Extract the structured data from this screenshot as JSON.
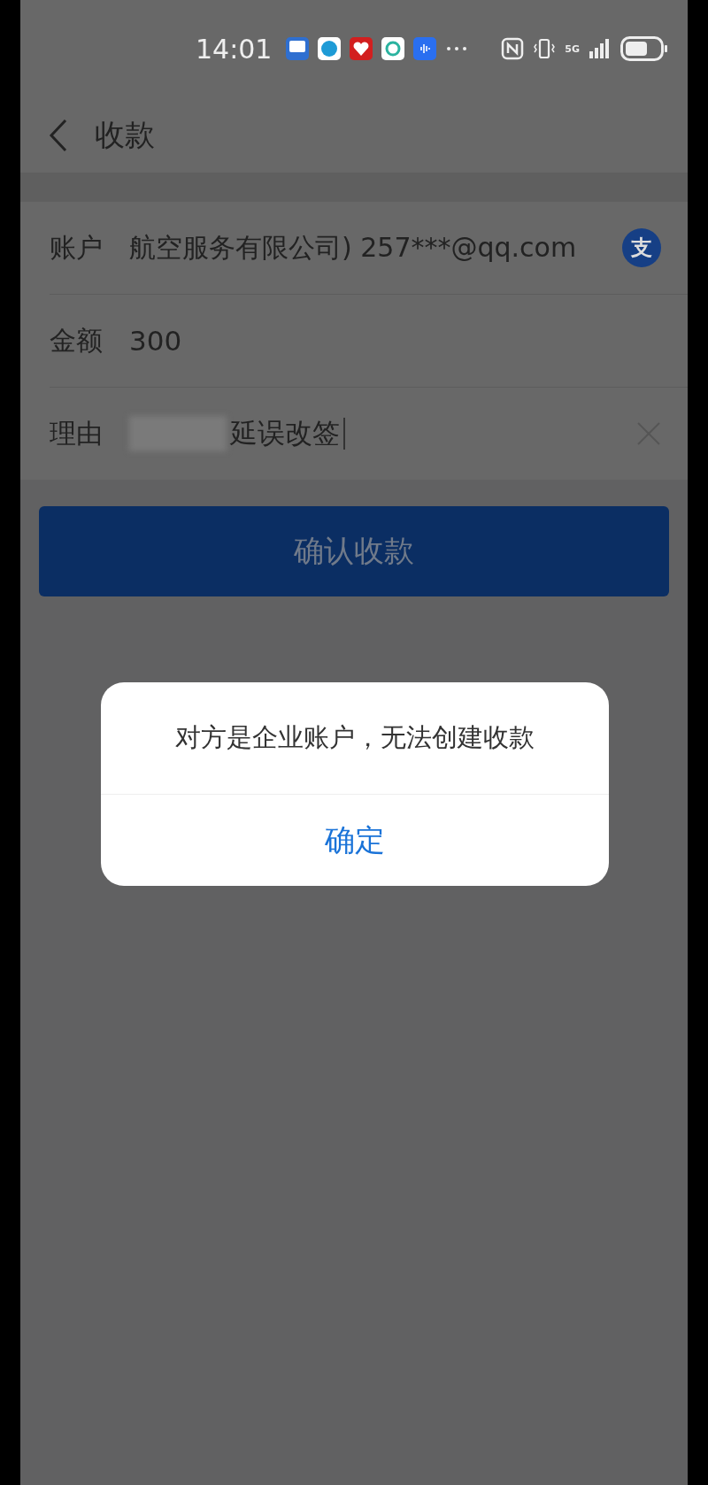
{
  "status_bar": {
    "time": "14:01",
    "network": "5G"
  },
  "header": {
    "title": "收款"
  },
  "form": {
    "rows": [
      {
        "kind": "account",
        "label": "账户",
        "value": "航空服务有限公司) 257***@qq.com",
        "badge": "支"
      },
      {
        "kind": "text",
        "label": "金额",
        "value": "300"
      },
      {
        "kind": "input",
        "label": "理由",
        "value": "延误改签"
      }
    ]
  },
  "submit_button": {
    "label": "确认收款",
    "disabled": true
  },
  "dialog": {
    "message": "对方是企业账户，无法创建收款",
    "button": "确定"
  }
}
